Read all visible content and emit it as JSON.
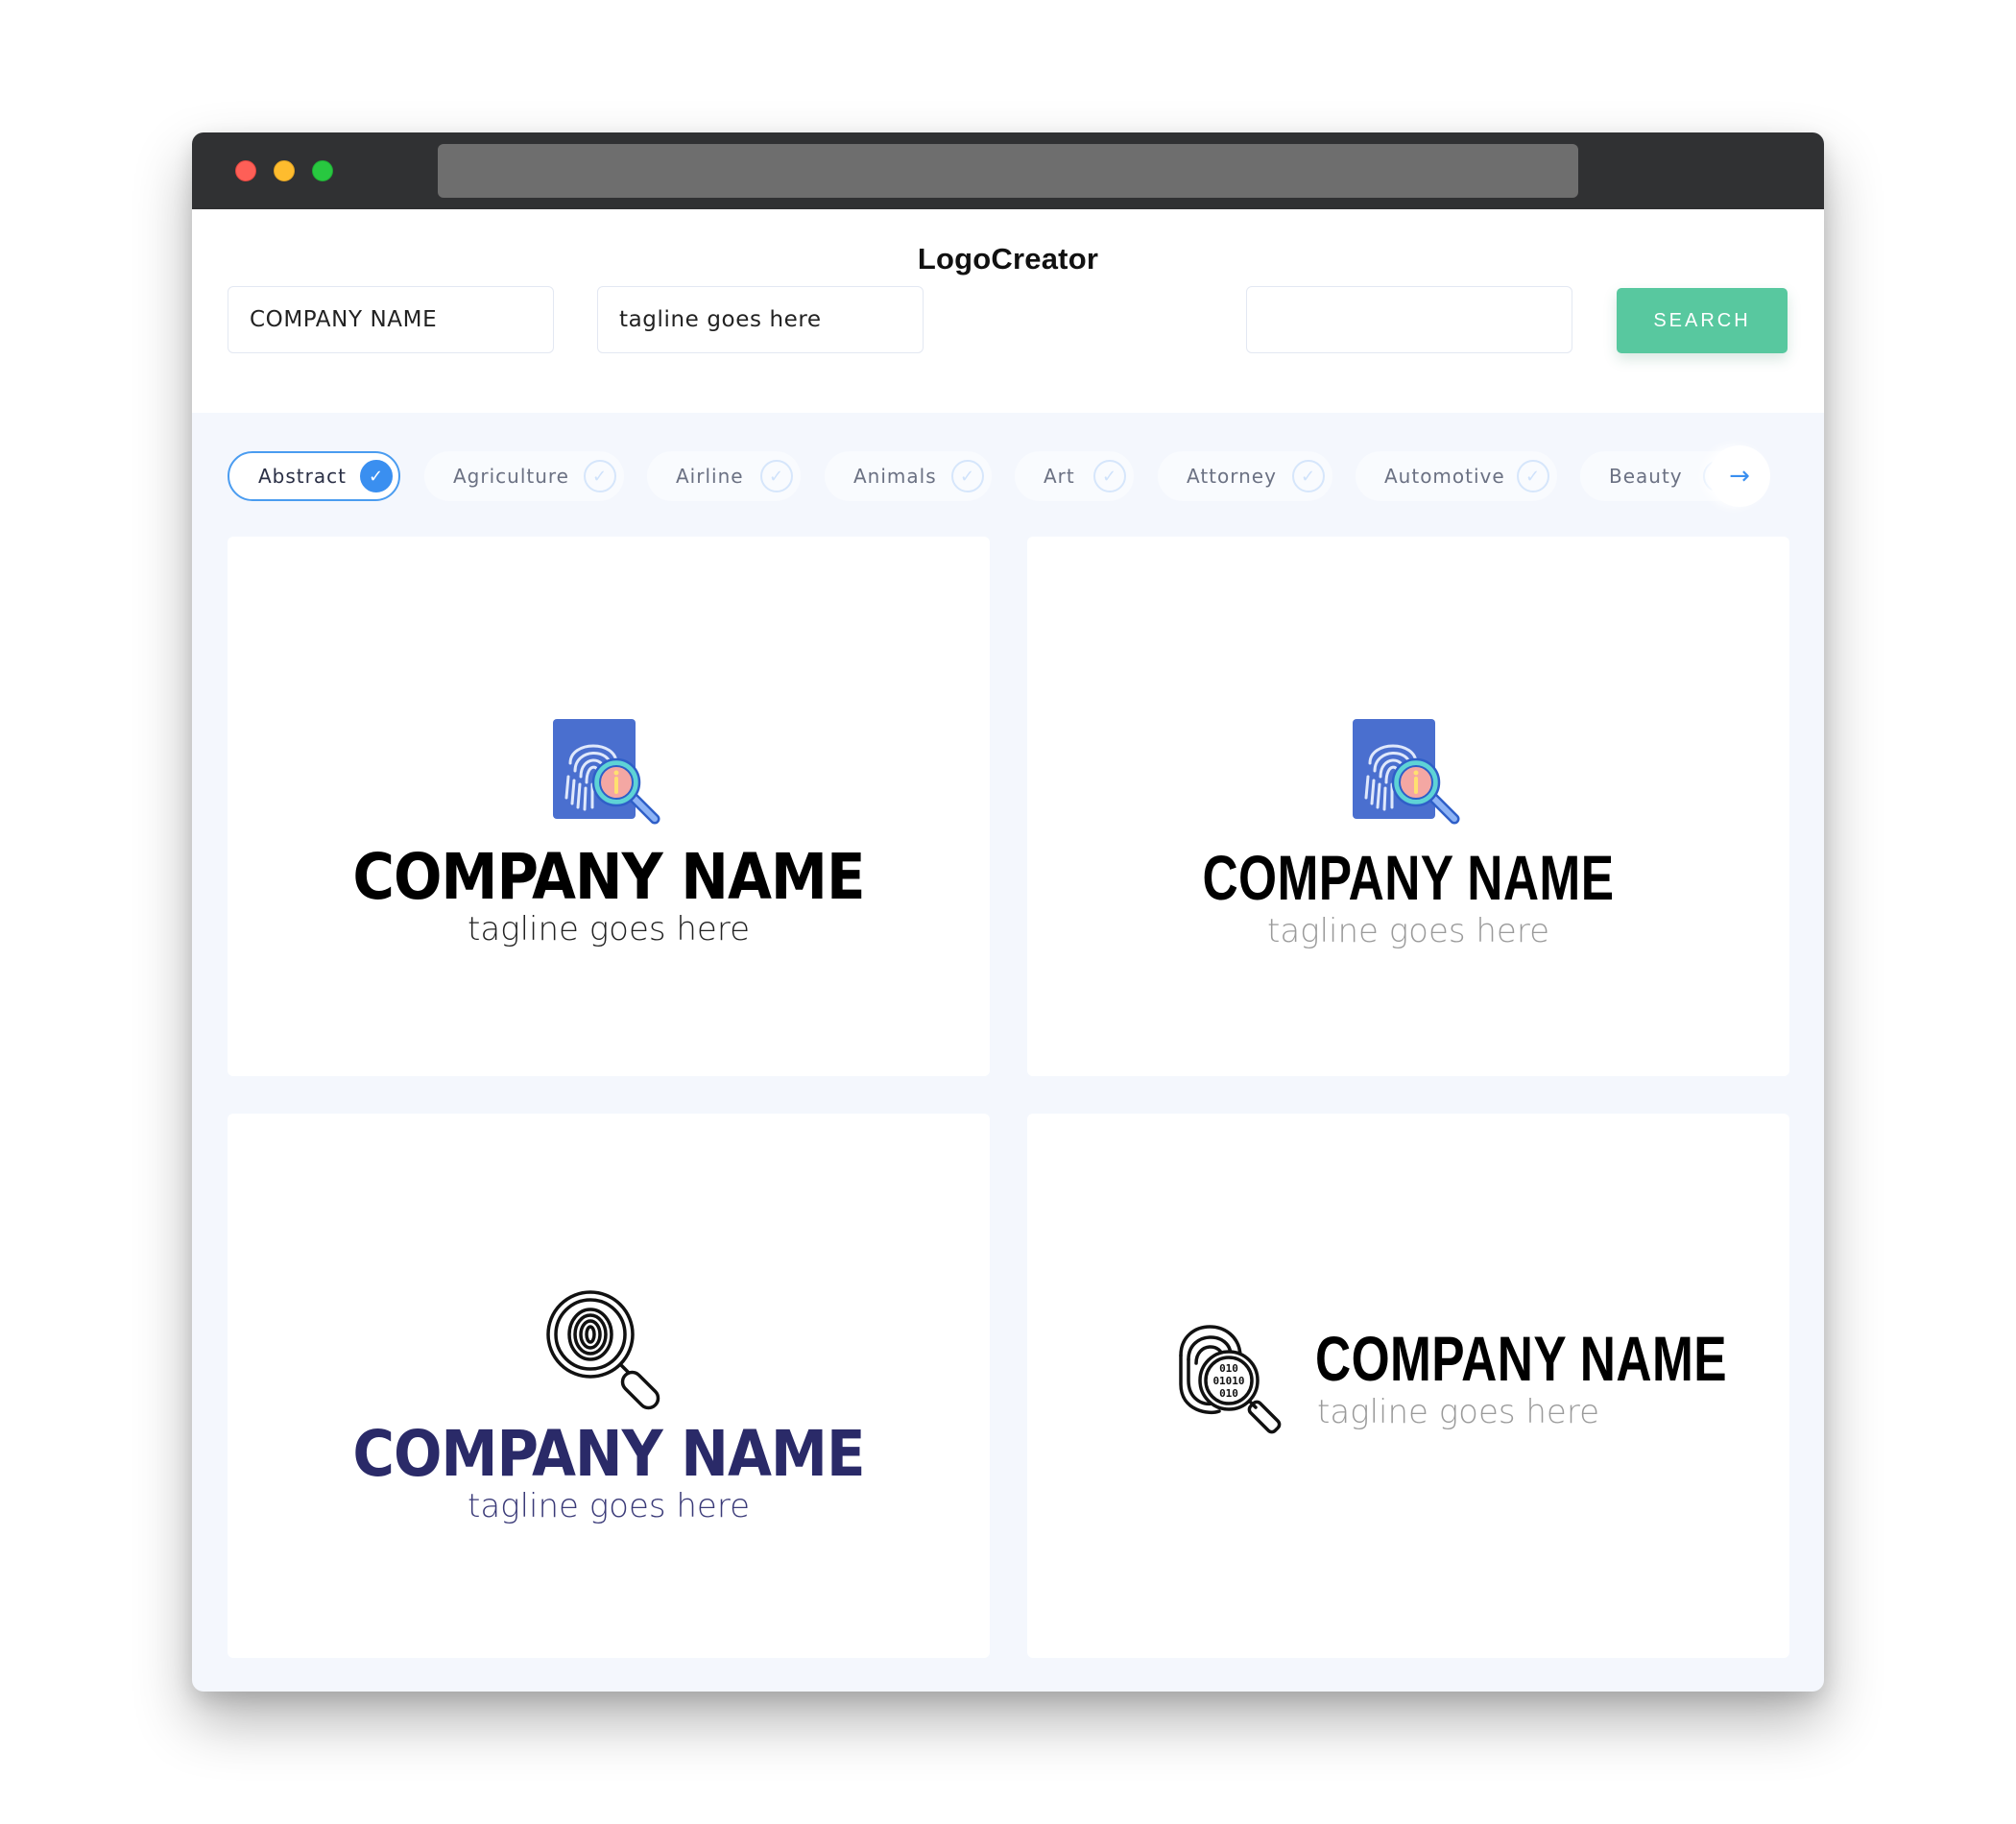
{
  "window": {
    "controls": [
      "close",
      "minimize",
      "maximize"
    ],
    "address_bar": ""
  },
  "header": {
    "title": "LogoCreator"
  },
  "search_form": {
    "company_name_value": "COMPANY NAME",
    "tagline_value": "tagline goes here",
    "keyword_value": "",
    "search_label": "SEARCH"
  },
  "colors": {
    "search_button": "#58c89f",
    "active_chip_border": "#4a9cf0",
    "check_blue": "#3a8ff0",
    "navy_text": "#2a2a68",
    "icon_doc_blue": "#4a6fcf",
    "icon_lens_pink": "#f4a7a3",
    "icon_lens_ring": "#5ed3d6"
  },
  "categories": {
    "items": [
      {
        "label": "Abstract",
        "selected": true
      },
      {
        "label": "Agriculture",
        "selected": false
      },
      {
        "label": "Airline",
        "selected": false
      },
      {
        "label": "Animals",
        "selected": false
      },
      {
        "label": "Art",
        "selected": false
      },
      {
        "label": "Attorney",
        "selected": false
      },
      {
        "label": "Automotive",
        "selected": false
      },
      {
        "label": "Beauty",
        "selected": false
      }
    ],
    "next_icon": "arrow-right-icon"
  },
  "logos": [
    {
      "icon": "fingerprint-document-search-icon",
      "company": "COMPANY NAME",
      "tagline": "tagline goes here",
      "style": "stacked-heavy"
    },
    {
      "icon": "fingerprint-document-search-icon",
      "company": "COMPANY NAME",
      "tagline": "tagline goes here",
      "style": "stacked-condensed"
    },
    {
      "icon": "fingerprint-magnifier-icon",
      "company": "COMPANY NAME",
      "tagline": "tagline goes here",
      "style": "stacked-heavy-navy"
    },
    {
      "icon": "fingerprint-binary-magnifier-icon",
      "company": "COMPANY NAME",
      "tagline": "tagline goes here",
      "style": "inline-condensed"
    }
  ],
  "binary_text": {
    "line1": "010",
    "line2": "01010",
    "line3": "010"
  }
}
